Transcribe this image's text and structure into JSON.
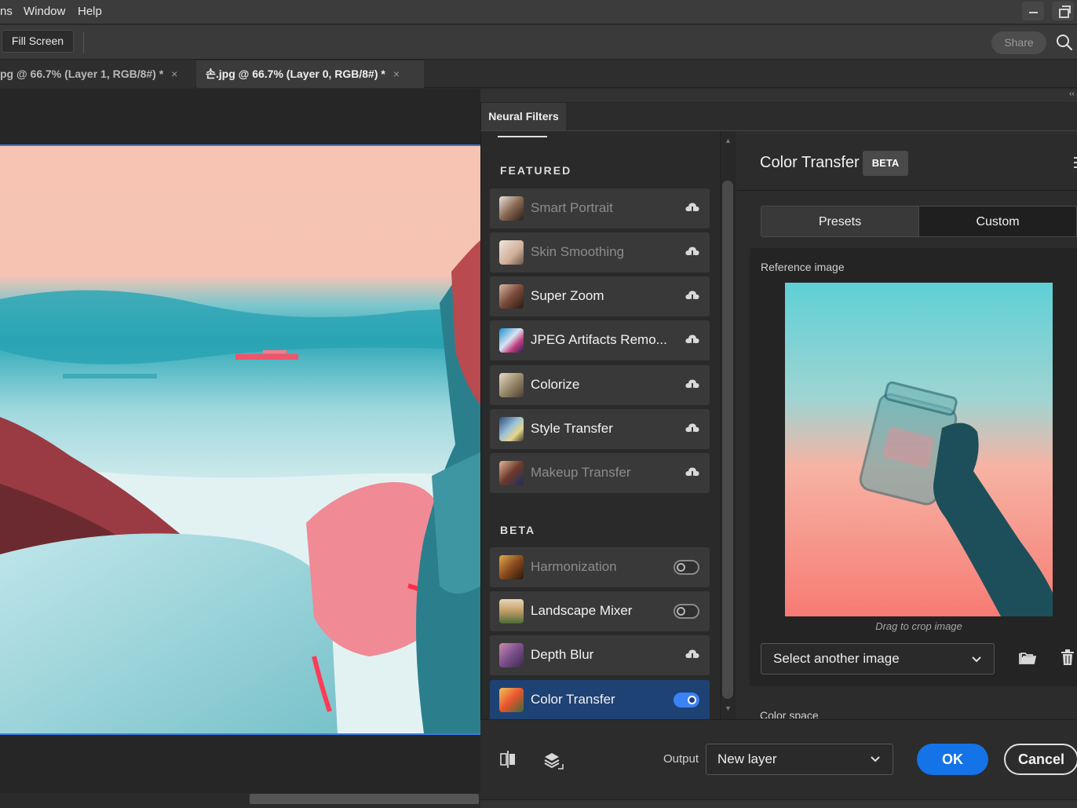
{
  "menu": {
    "items": [
      "ns",
      "Window",
      "Help"
    ]
  },
  "options_bar": {
    "fill_screen_label": "Fill Screen",
    "share_label": "Share"
  },
  "tabs": [
    {
      "label": "pg @ 66.7% (Layer 1, RGB/8#) *",
      "close": "×"
    },
    {
      "label": "손.jpg @ 66.7% (Layer 0, RGB/8#) *",
      "close": "×"
    }
  ],
  "panel": {
    "tab_label": "Neural Filters",
    "collapse_glyph": "‹‹",
    "featured_title": "FEATURED",
    "beta_title": "BETA",
    "featured": [
      {
        "label": "Smart Portrait",
        "enabled": false,
        "action": "cloud-download-icon"
      },
      {
        "label": "Skin Smoothing",
        "enabled": false,
        "action": "cloud-download-icon"
      },
      {
        "label": "Super Zoom",
        "enabled": true,
        "action": "cloud-download-icon"
      },
      {
        "label": "JPEG Artifacts Remo...",
        "enabled": true,
        "action": "cloud-download-icon"
      },
      {
        "label": "Colorize",
        "enabled": true,
        "action": "cloud-download-icon"
      },
      {
        "label": "Style Transfer",
        "enabled": true,
        "action": "cloud-download-icon"
      },
      {
        "label": "Makeup Transfer",
        "enabled": false,
        "action": "cloud-download-icon"
      }
    ],
    "beta": [
      {
        "label": "Harmonization",
        "enabled": false,
        "action": "toggle",
        "on": false
      },
      {
        "label": "Landscape Mixer",
        "enabled": true,
        "action": "toggle",
        "on": false
      },
      {
        "label": "Depth Blur",
        "enabled": true,
        "action": "cloud-download-icon"
      },
      {
        "label": "Color Transfer",
        "enabled": true,
        "action": "toggle",
        "on": true,
        "selected": true
      }
    ]
  },
  "settings": {
    "title": "Color Transfer",
    "badge": "BETA",
    "segments": [
      "Presets",
      "Custom"
    ],
    "active_segment": "Custom",
    "reference_label": "Reference image",
    "drag_hint": "Drag to crop image",
    "select_image": "Select another image",
    "color_space_label": "Color space"
  },
  "bottom": {
    "output_label": "Output",
    "output_value": "New layer",
    "ok_label": "OK",
    "cancel_label": "Cancel"
  },
  "colors": {
    "accent": "#1473e6",
    "selected_item": "#1e4273",
    "panel_bg": "#2c2c2c",
    "canvas_selection": "#3a7ae0"
  }
}
